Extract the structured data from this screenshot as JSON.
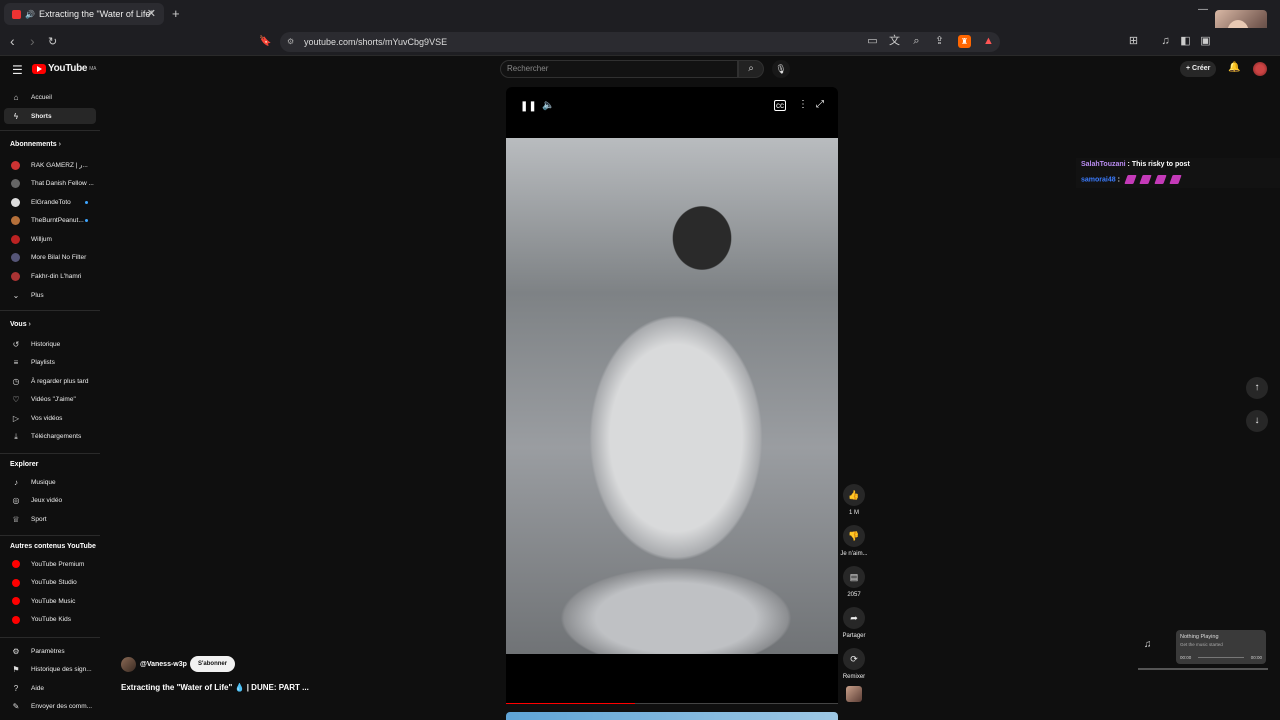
{
  "browser": {
    "tab_title": "Extracting the \"Water of Life\"",
    "url": "youtube.com/shorts/mYuvCbg9VSE"
  },
  "header": {
    "logo_text": "YouTube",
    "logo_country": "MA",
    "search_placeholder": "Rechercher",
    "create_label": "Créer"
  },
  "sidebar": {
    "main": [
      {
        "label": "Accueil",
        "icon": "home-icon"
      },
      {
        "label": "Shorts",
        "icon": "shorts-icon",
        "active": true
      }
    ],
    "subscriptions_header": "Abonnements",
    "subscriptions": [
      {
        "label": "RAK GAMERZ | ر...",
        "live": false,
        "color": "#c33"
      },
      {
        "label": "That Danish Fellow ...",
        "live": false,
        "color": "#666"
      },
      {
        "label": "ElGrandeToto",
        "live": true,
        "color": "#ddd"
      },
      {
        "label": "TheBurntPeanut...",
        "live": true,
        "color": "#b5703a"
      },
      {
        "label": "Willjum",
        "live": false,
        "color": "#b22"
      },
      {
        "label": "More Bilal No Filter",
        "live": false,
        "color": "#557"
      },
      {
        "label": "Fakhr-din L'hamri",
        "live": false,
        "color": "#a33"
      }
    ],
    "more_label": "Plus",
    "you_header": "Vous",
    "you": [
      {
        "label": "Historique",
        "icon": "history-icon"
      },
      {
        "label": "Playlists",
        "icon": "playlists-icon"
      },
      {
        "label": "À regarder plus tard",
        "icon": "watch-later-icon"
      },
      {
        "label": "Vidéos \"J'aime\"",
        "icon": "liked-icon"
      },
      {
        "label": "Vos vidéos",
        "icon": "your-videos-icon"
      },
      {
        "label": "Téléchargements",
        "icon": "download-icon"
      }
    ],
    "explore_header": "Explorer",
    "explore": [
      {
        "label": "Musique",
        "icon": "music-icon"
      },
      {
        "label": "Jeux vidéo",
        "icon": "gaming-icon"
      },
      {
        "label": "Sport",
        "icon": "trophy-icon"
      }
    ],
    "more_yt_header": "Autres contenus YouTube",
    "more_yt": [
      {
        "label": "YouTube Premium"
      },
      {
        "label": "YouTube Studio"
      },
      {
        "label": "YouTube Music"
      },
      {
        "label": "YouTube Kids"
      }
    ],
    "settings": [
      {
        "label": "Paramètres",
        "icon": "gear-icon"
      },
      {
        "label": "Historique des sign...",
        "icon": "flag-icon"
      },
      {
        "label": "Aide",
        "icon": "help-icon"
      },
      {
        "label": "Envoyer des comm...",
        "icon": "feedback-icon"
      }
    ]
  },
  "short": {
    "channel": "@Vaness-w3p",
    "subscribe_label": "S'abonner",
    "title": "Extracting the \"Water of Life\" 💧 | DUNE: PART ...",
    "progress": 0.39,
    "actions": {
      "likes": "1 M",
      "dislike_label": "Je n'aim...",
      "comments": "2057",
      "share_label": "Partager",
      "remix_label": "Remixer"
    }
  },
  "chat": [
    {
      "user": "SalahTouzani",
      "user_color": "#b98cf0",
      "text": " : This risky to post"
    },
    {
      "user": "samorai48",
      "user_color": "#3b7cff",
      "text": " :",
      "emotes": 4
    }
  ],
  "music_widget": {
    "title": "Nothing Playing",
    "subtitle": "Get the music started",
    "time_start": "00:00",
    "time_end": "00:00"
  }
}
